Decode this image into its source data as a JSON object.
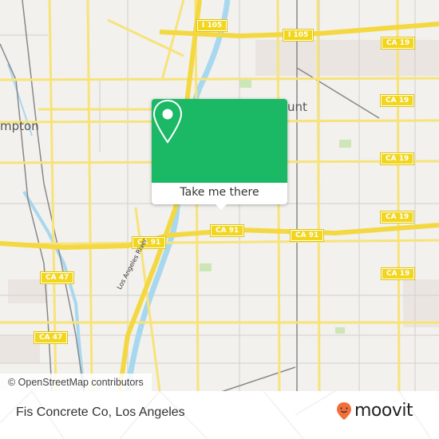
{
  "map": {
    "place_labels": [
      {
        "id": "compton",
        "text": "mpton"
      },
      {
        "id": "lynwood-partial",
        "text": "unt"
      }
    ],
    "shields": [
      {
        "text": "I 105"
      },
      {
        "text": "I 105"
      },
      {
        "text": "CA 19"
      },
      {
        "text": "CA 19"
      },
      {
        "text": "CA 19"
      },
      {
        "text": "CA 19"
      },
      {
        "text": "CA 19"
      },
      {
        "text": "CA 91"
      },
      {
        "text": "CA 91"
      },
      {
        "text": "CA 91"
      },
      {
        "text": "CA 47"
      },
      {
        "text": "CA 47"
      }
    ],
    "river_label": "Los Angeles River",
    "attribution": "© OpenStreetMap contributors",
    "colors": {
      "background": "#f2f1ed",
      "road": "#f7e37a",
      "water": "#a8d8ef",
      "rail": "#777777"
    }
  },
  "popup": {
    "icon": "location-pin-icon",
    "button_label": "Take me there",
    "color": "#1bb866"
  },
  "footer": {
    "title": "Fis Concrete Co, Los Angeles",
    "logo_text": "moovit",
    "logo_color": "#f26f3a"
  }
}
